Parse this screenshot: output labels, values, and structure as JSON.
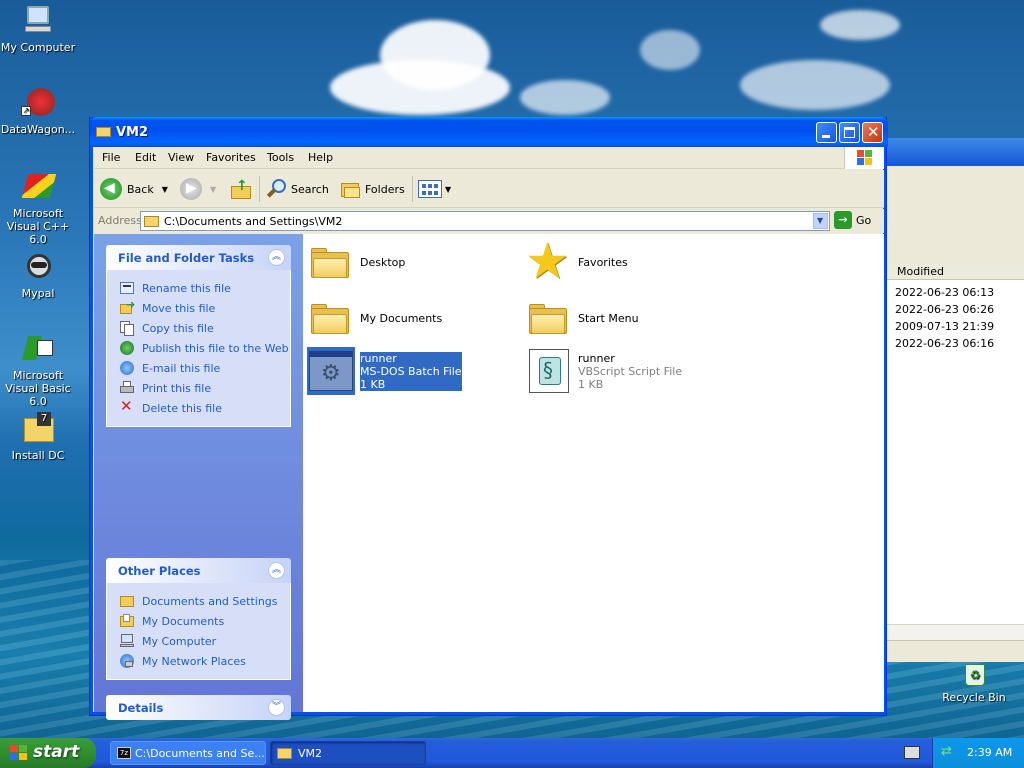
{
  "desktop": {
    "icons": [
      {
        "label": "My Computer"
      },
      {
        "label": "DataWagon..."
      },
      {
        "label": "Microsoft Visual C++ 6.0"
      },
      {
        "label": "Mypal"
      },
      {
        "label": "Microsoft Visual Basic 6.0"
      },
      {
        "label": "Install DC"
      },
      {
        "label": "Recycle Bin"
      }
    ]
  },
  "background_window": {
    "column_header": "Modified",
    "rows": [
      "2022-06-23 06:13",
      "2022-06-23 06:26",
      "2009-07-13 21:39",
      "2022-06-23 06:16"
    ]
  },
  "window": {
    "title": "VM2",
    "menu": [
      "File",
      "Edit",
      "View",
      "Favorites",
      "Tools",
      "Help"
    ],
    "toolbar": {
      "back": "Back",
      "search": "Search",
      "folders": "Folders"
    },
    "address": {
      "label": "Address",
      "value": "C:\\Documents and Settings\\VM2",
      "go": "Go"
    },
    "tasks_panel": {
      "title": "File and Folder Tasks",
      "items": [
        "Rename this file",
        "Move this file",
        "Copy this file",
        "Publish this file to the Web",
        "E-mail this file",
        "Print this file",
        "Delete this file"
      ]
    },
    "other_places": {
      "title": "Other Places",
      "items": [
        "Documents and Settings",
        "My Documents",
        "My Computer",
        "My Network Places"
      ]
    },
    "details": {
      "title": "Details"
    },
    "files": [
      {
        "name": "Desktop"
      },
      {
        "name": "Favorites"
      },
      {
        "name": "My Documents"
      },
      {
        "name": "Start Menu"
      },
      {
        "name": "runner",
        "type": "MS-DOS Batch File",
        "size": "1 KB",
        "selected": true
      },
      {
        "name": "runner",
        "type": "VBScript Script File",
        "size": "1 KB"
      }
    ]
  },
  "taskbar": {
    "start": "start",
    "tasks": [
      "C:\\Documents and Se...",
      "VM2"
    ],
    "clock": "2:39 AM"
  },
  "colors": {
    "xp_blue": "#0054e3",
    "task_link": "#215dc6",
    "selection": "#316ac5",
    "start_green": "#2f8f2f"
  }
}
